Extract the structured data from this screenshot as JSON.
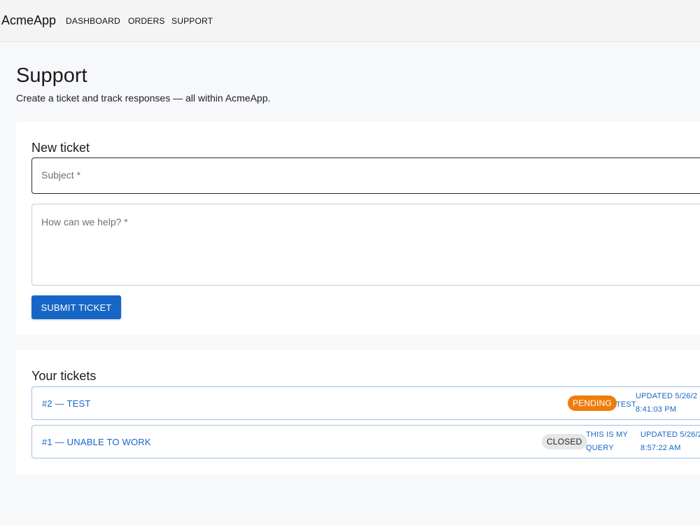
{
  "app": {
    "brand": "AcmeApp",
    "nav": [
      "DASHBOARD",
      "ORDERS",
      "SUPPORT"
    ]
  },
  "page": {
    "title": "Support",
    "subtitle": "Create a ticket and track responses — all within AcmeApp."
  },
  "new_ticket": {
    "heading": "New ticket",
    "subject_placeholder": "Subject *",
    "message_placeholder": "How can we help? *",
    "submit_label": "SUBMIT TICKET"
  },
  "tickets": {
    "heading": "Your tickets",
    "items": [
      {
        "title": "#2 — TEST",
        "status": "PENDING",
        "query": "TEST",
        "updated_line1": "UPDATED 5/26/2",
        "updated_line2": "8:41:03 PM"
      },
      {
        "title": "#1 — UNABLE TO WORK",
        "status": "CLOSED",
        "query_line1": "THIS IS MY",
        "query_line2": "QUERY",
        "updated_line1": "UPDATED 5/26/2",
        "updated_line2": "8:57:22 AM"
      }
    ]
  },
  "colors": {
    "primary": "#1766c6",
    "pending": "#ef7d0c",
    "closed": "#e5e6e8"
  }
}
